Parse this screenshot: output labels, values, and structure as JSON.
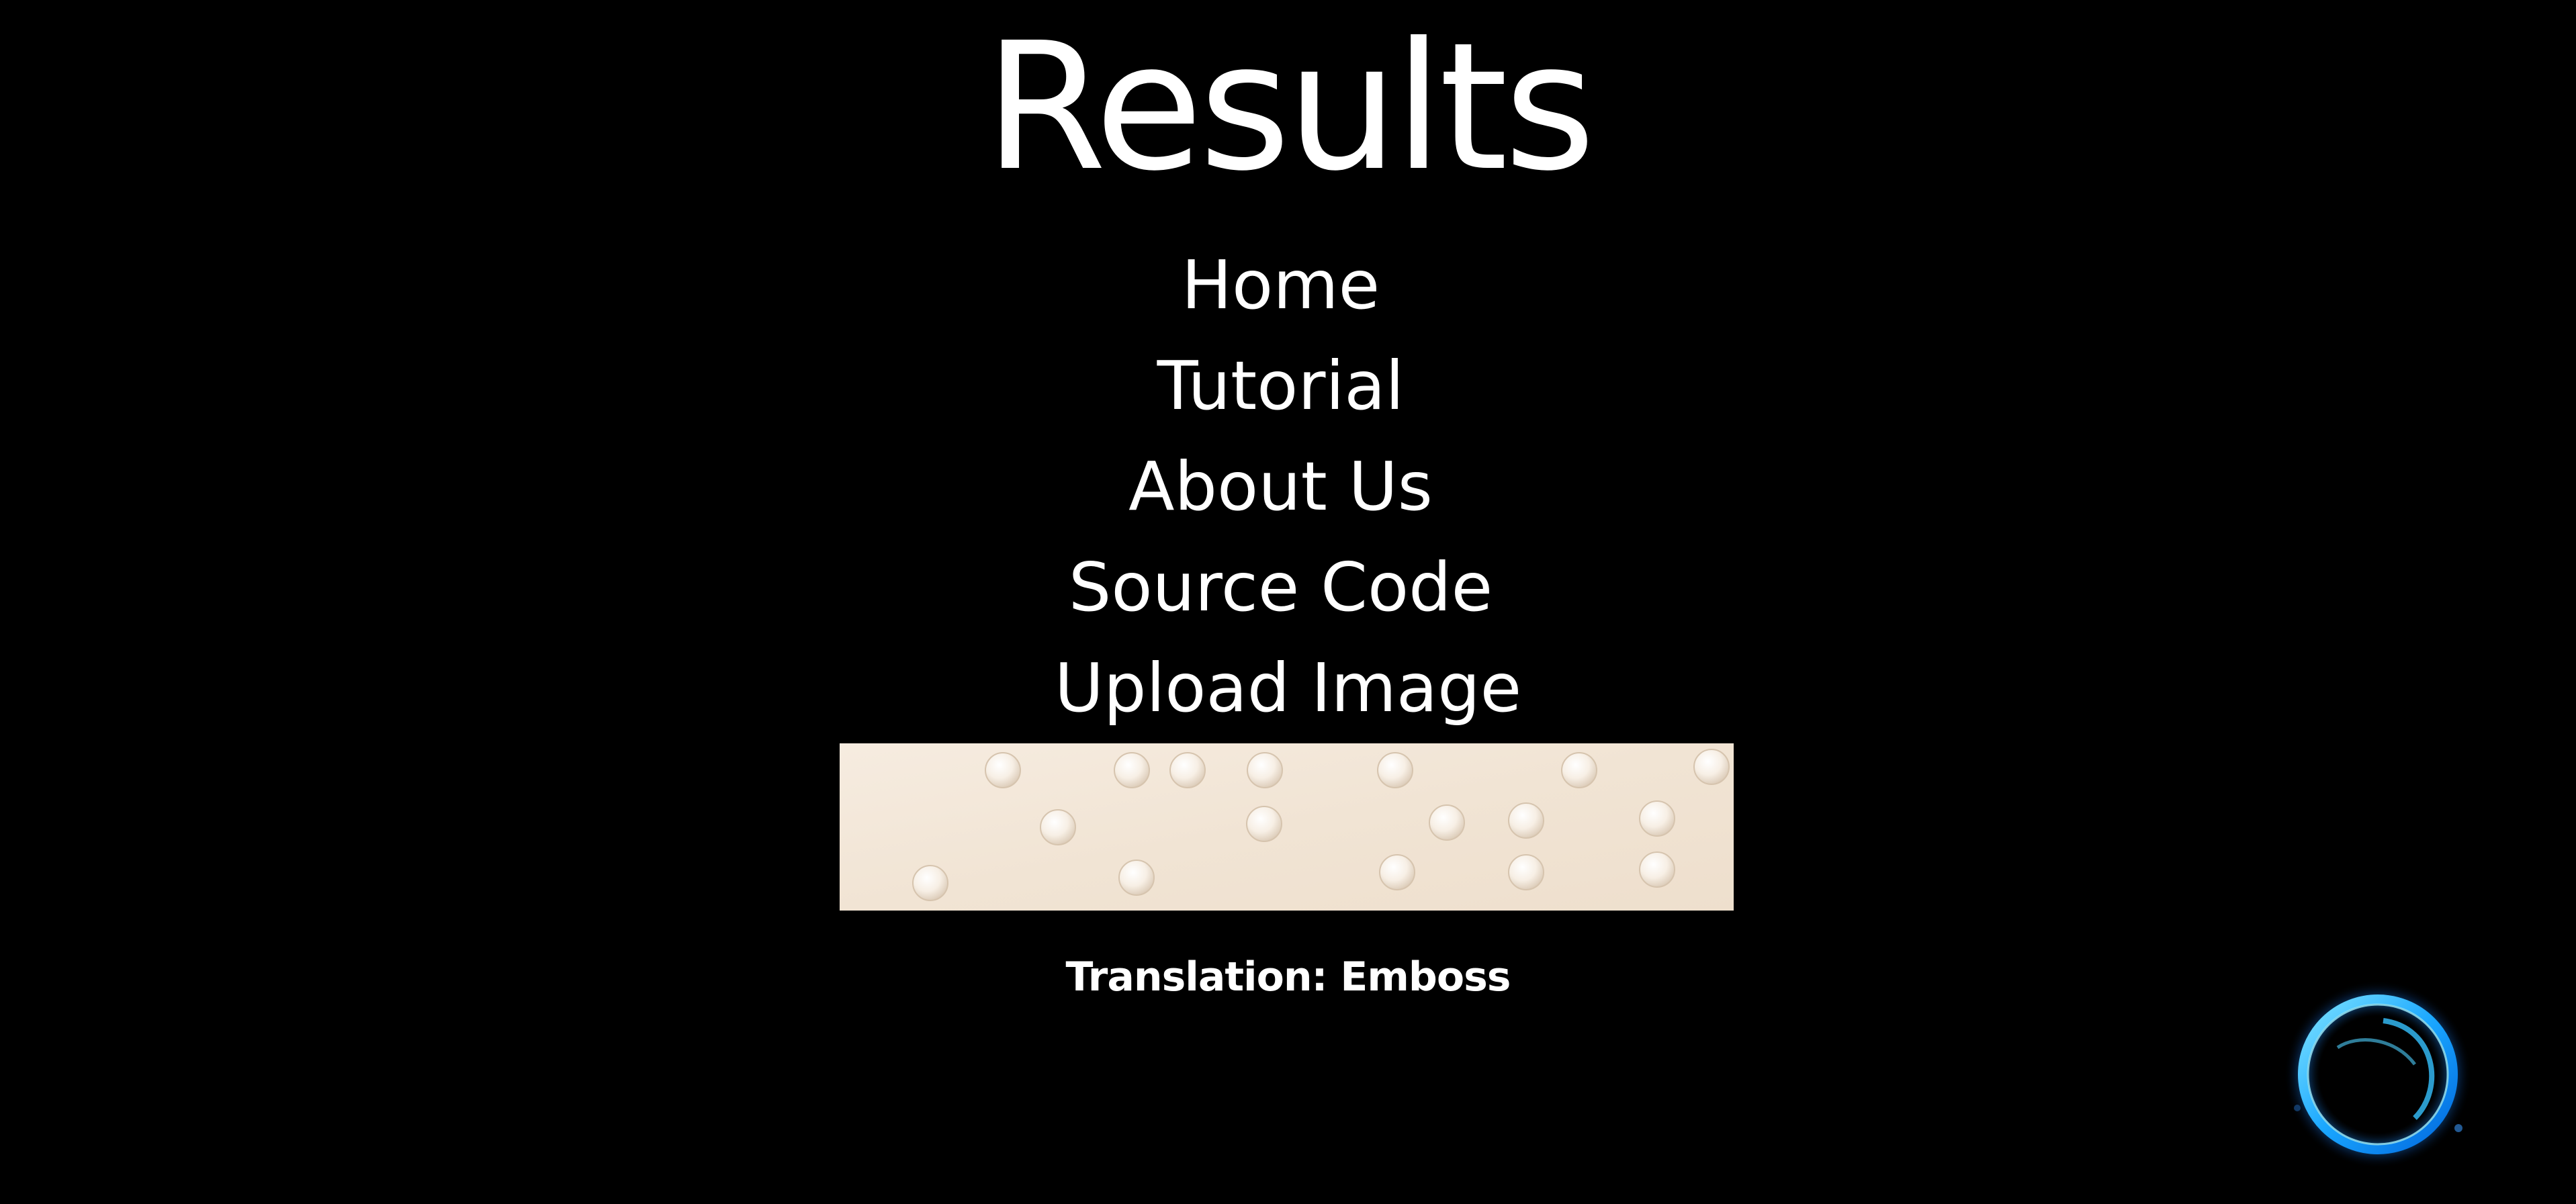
{
  "header": {
    "title": "Results"
  },
  "nav": {
    "items": [
      {
        "label": "Home"
      },
      {
        "label": "Tutorial"
      },
      {
        "label": "About Us"
      },
      {
        "label": "Source Code"
      },
      {
        "label": "Upload Image"
      }
    ]
  },
  "result": {
    "image_icon": "braille-embossed-paper",
    "translation": "Translation: Emboss"
  },
  "widget": {
    "icon": "glowing-ring-icon"
  },
  "colors": {
    "background": "#000000",
    "text": "#ffffff",
    "paper": "#f3e7d8",
    "orb": "#1aa7ff"
  }
}
